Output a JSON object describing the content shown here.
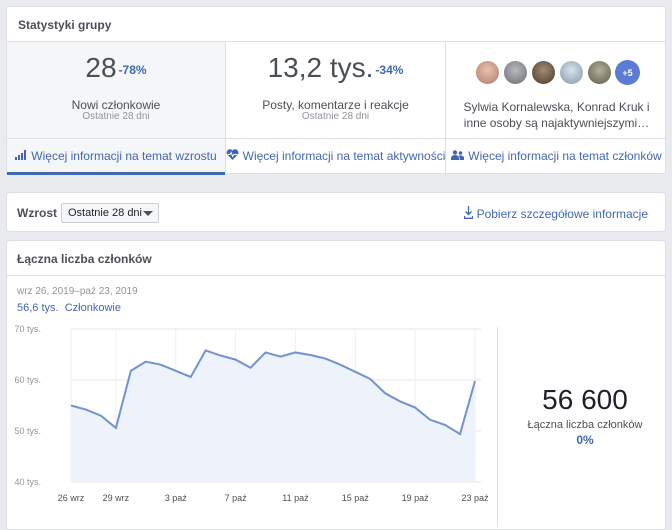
{
  "stats": {
    "title": "Statystyki grupy",
    "new_members": {
      "value": "28",
      "change": "-78%",
      "label": "Nowi członkowie",
      "period": "Ostatnie 28 dni",
      "link": "Więcej informacji na temat wzrostu",
      "link_icon": "bar-chart-icon"
    },
    "posts": {
      "value": "13,2 tys.",
      "change": "-34%",
      "label": "Posty, komentarze i reakcje",
      "period": "Ostatnie 28 dni",
      "link": "Więcej informacji na temat aktywności",
      "link_icon": "heart-pulse-icon"
    },
    "members": {
      "avatar_colors": [
        "#c79a8a",
        "#8d8f93",
        "#6b5a4a",
        "#9fb4c4",
        "#7a7a6a"
      ],
      "more": "+5",
      "text": "Sylwia Kornalewska, Konrad Kruk i inne osoby są najaktywniejszymi…",
      "link": "Więcej informacji na temat członków",
      "link_icon": "people-icon"
    }
  },
  "growth": {
    "title": "Wzrost",
    "period_select": "Ostatnie 28 dni",
    "download": "Pobierz szczegółowe informacje",
    "download_icon": "download-icon"
  },
  "members_card": {
    "title": "Łączna liczba członków",
    "date_range": "wrz 26, 2019–paź 23, 2019",
    "series_value": "56,6 tys.",
    "series_name": "Członkowie",
    "total": "56 600",
    "total_label": "Łączna liczba członków",
    "total_change": "0%"
  },
  "chart_data": {
    "type": "area",
    "y_tick_labels": [
      "40 tys.",
      "50 tys.",
      "60 tys.",
      "70 tys."
    ],
    "ylim": [
      40000,
      70000
    ],
    "y_ticks": [
      40000,
      50000,
      60000,
      70000
    ],
    "x_tick_labels": [
      "26 wrz",
      "29 wrz",
      "3 paź",
      "7 paź",
      "11 paź",
      "15 paź",
      "19 paź",
      "23 paź"
    ],
    "x_tick_index": [
      0,
      3,
      7,
      11,
      15,
      19,
      23,
      27
    ],
    "series": [
      {
        "name": "Członkowie",
        "color": "#7292d0",
        "values": [
          55000,
          54200,
          53000,
          50600,
          61800,
          63600,
          63000,
          61800,
          60600,
          65800,
          64800,
          64000,
          62400,
          65400,
          64600,
          65400,
          64900,
          64200,
          63000,
          61600,
          60200,
          57400,
          55800,
          54600,
          52200,
          51200,
          49400,
          59800
        ]
      }
    ],
    "grid": true
  }
}
